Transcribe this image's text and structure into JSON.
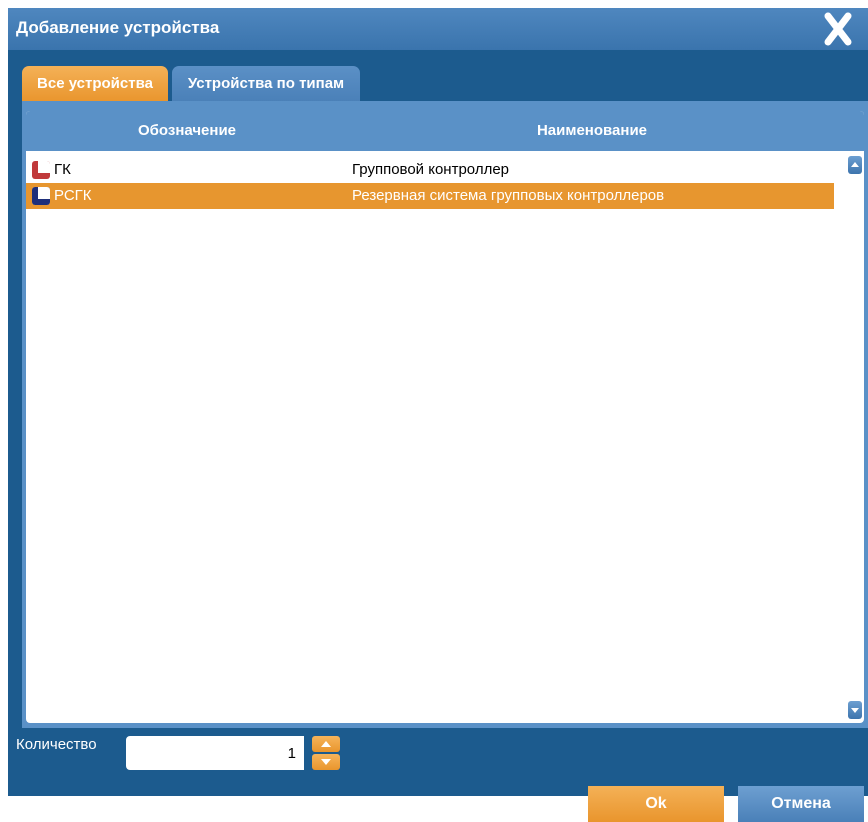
{
  "dialog": {
    "title": "Добавление устройства",
    "close_icon": "close-x-icon"
  },
  "tabs": [
    {
      "label": "Все устройства",
      "active": true
    },
    {
      "label": "Устройства по типам",
      "active": false
    }
  ],
  "table": {
    "columns": [
      "Обозначение",
      "Наименование"
    ],
    "rows": [
      {
        "code": "ГК",
        "name": "Групповой контроллер",
        "icon": "gk-device-icon",
        "selected": false
      },
      {
        "code": "РСГК",
        "name": "Резервная система групповых контроллеров",
        "icon": "rsgk-device-icon",
        "selected": true
      }
    ]
  },
  "quantity": {
    "label": "Количество",
    "value": "1"
  },
  "buttons": {
    "ok": "Ok",
    "cancel": "Отмена"
  },
  "colors": {
    "dialog_bg": "#1c5b8e",
    "titlebar": "#4f87bf",
    "accent_orange": "#e9952d",
    "panel_blue": "#5a91c7"
  }
}
